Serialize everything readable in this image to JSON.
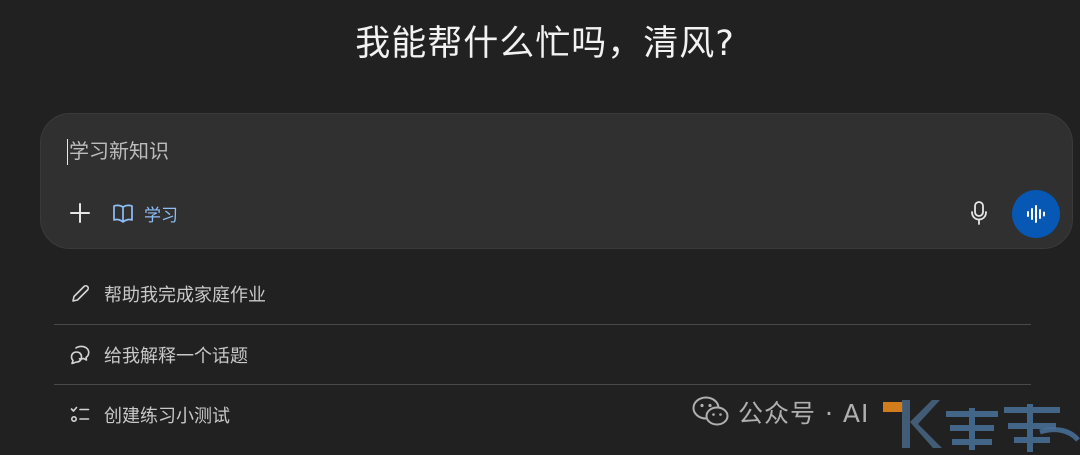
{
  "header": {
    "greeting": "我能帮什么忙吗，清风?"
  },
  "composer": {
    "placeholder": "学习新知识",
    "mode_chip_label": "学习",
    "icons": {
      "add": "plus-icon",
      "mode": "open-book-icon",
      "mic": "microphone-icon",
      "voice": "voice-waveform-icon"
    }
  },
  "suggestions": [
    {
      "label": "帮助我完成家庭作业",
      "icon": "pencil-icon"
    },
    {
      "label": "给我解释一个话题",
      "icon": "chat-bubbles-icon"
    },
    {
      "label": "创建练习小测试",
      "icon": "checklist-icon"
    }
  ],
  "watermark": {
    "text": "公众号 · AI",
    "icon": "wechat-icon"
  },
  "colors": {
    "background": "#212121",
    "composer": "#303030",
    "accent_link": "#8fbef5",
    "voice_button": "#0658b4"
  }
}
